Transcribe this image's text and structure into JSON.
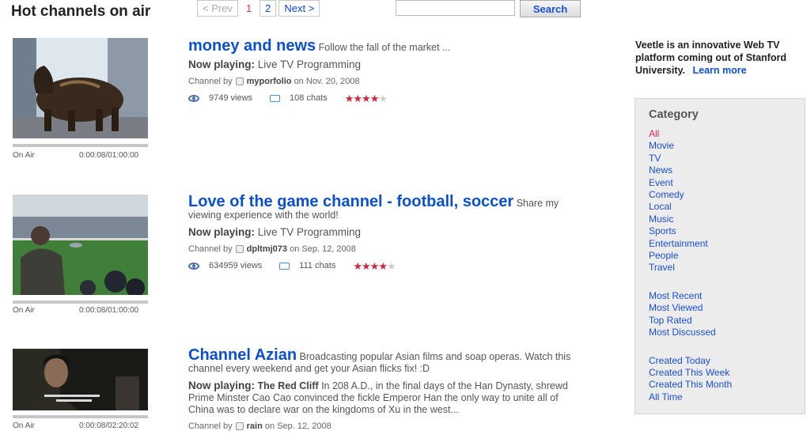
{
  "page": {
    "title": "Hot channels on air"
  },
  "pager": {
    "prev": "< Prev",
    "pages": [
      "1",
      "2"
    ],
    "next": "Next >"
  },
  "search": {
    "button": "Search",
    "value": ""
  },
  "about": {
    "text": "Veetle is an innovative Web TV platform coming out of Stanford University.",
    "link": "Learn more"
  },
  "channels": [
    {
      "title": "money and news",
      "desc": "Follow the fall of the market ...",
      "now_label": "Now playing:",
      "now_text": "Live TV Programming",
      "now_bold": "",
      "by_label": "Channel by",
      "user": "myporfolio",
      "on_label": "on",
      "date": "Nov. 20, 2008",
      "views": "9749 views",
      "chats": "108 chats",
      "rating": 4,
      "status": "On Air",
      "time": "0:00:08/01:00:00"
    },
    {
      "title": "Love of the game channel - football, soccer",
      "desc": "Share my viewing experience with the world!",
      "now_label": "Now playing:",
      "now_text": "Live TV Programming",
      "now_bold": "",
      "by_label": "Channel by",
      "user": "dpltmj073",
      "on_label": "on",
      "date": "Sep. 12, 2008",
      "views": "634959 views",
      "chats": "111 chats",
      "rating": 4,
      "status": "On Air",
      "time": "0:00:08/01:00:00"
    },
    {
      "title": "Channel Azian",
      "desc": "Broadcasting popular Asian films and soap operas. Watch this channel every weekend and get your Asian flicks fix! :D",
      "now_label": "Now playing:",
      "now_bold": "The Red Cliff",
      "now_text": "In 208 A.D., in the final days of the Han Dynasty, shrewd Prime Minster Cao Cao convinced the fickle Emperor Han the only way to unite all of China was to declare war on the kingdoms of Xu in the west...",
      "by_label": "Channel by",
      "user": "rain",
      "on_label": "on",
      "date": "Sep. 12, 2008",
      "status": "On Air",
      "time": "0:00:08/02:20:02"
    }
  ],
  "category": {
    "heading": "Category",
    "types": [
      "All",
      "Movie",
      "TV",
      "News",
      "Event",
      "Comedy",
      "Local",
      "Music",
      "Sports",
      "Entertainment",
      "People",
      "Travel"
    ],
    "sorts": [
      "Most Recent",
      "Most Viewed",
      "Top Rated",
      "Most Discussed"
    ],
    "dates": [
      "Created Today",
      "Created This Week",
      "Created This Month",
      "All Time"
    ]
  },
  "colors": {
    "link": "#0b50d0",
    "active": "#e0246b",
    "star": "#d8243a"
  }
}
